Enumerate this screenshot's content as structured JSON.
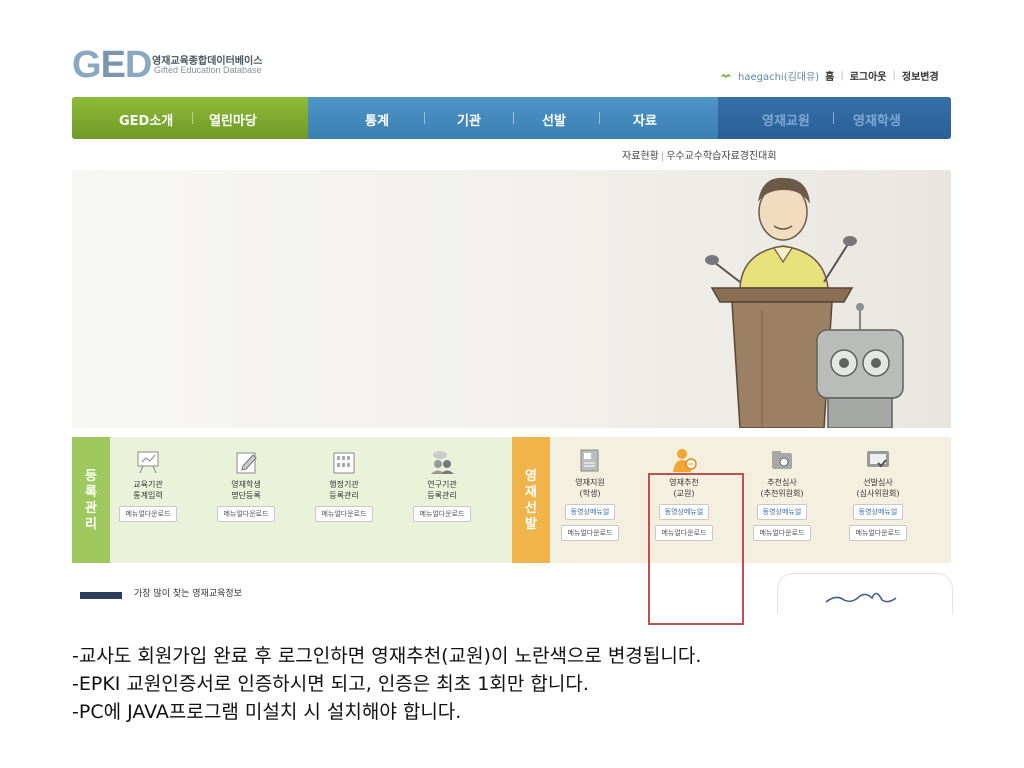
{
  "logo": {
    "letters": [
      "G",
      "E",
      "D"
    ],
    "kr": "영재교육종합데이터베이스",
    "en": "Gifted Education Database"
  },
  "toplinks": {
    "user": "haegachi(김대유)",
    "home": "홈",
    "logout": "로그아웃",
    "info": "정보변경"
  },
  "nav": {
    "items": [
      "GED소개",
      "열린마당",
      "통계",
      "기관",
      "선발",
      "자료",
      "영재교원",
      "영재학생"
    ]
  },
  "subnav": {
    "items": [
      "자료현황",
      "우수교수학습자료경진대회"
    ]
  },
  "panel": {
    "reg_title": [
      "등",
      "록",
      "관",
      "리"
    ],
    "sel_title": [
      "영",
      "재",
      "선",
      "발"
    ],
    "reg_items": [
      {
        "l1": "교육기관",
        "l2": "통계입력",
        "btn": "메뉴얼다운로드"
      },
      {
        "l1": "영재학생",
        "l2": "명단등록",
        "btn": "메뉴얼다운로드"
      },
      {
        "l1": "행정기관",
        "l2": "등록관리",
        "btn": "메뉴얼다운로드"
      },
      {
        "l1": "연구기관",
        "l2": "등록관리",
        "btn": "메뉴얼다운로드"
      }
    ],
    "sel_items": [
      {
        "l1": "영재지원",
        "l2": "(학생)",
        "video": "동영상메뉴얼",
        "btn": "메뉴얼다운로드"
      },
      {
        "l1": "영재추천",
        "l2": "(교원)",
        "video": "동영상메뉴얼",
        "btn": "메뉴얼다운로드"
      },
      {
        "l1": "추천심사",
        "l2": "(추천위원회)",
        "video": "동영상메뉴얼",
        "btn": "메뉴얼다운로드"
      },
      {
        "l1": "선발심사",
        "l2": "(심사위원회)",
        "video": "동영상메뉴얼",
        "btn": "메뉴얼다운로드"
      }
    ]
  },
  "bottom": {
    "popular": "가장 많이 찾는 영재교육정보"
  },
  "notes": [
    "-교사도 회원가입 완료 후 로그인하면 영재추천(교원)이 노란색으로 변경됩니다.",
    "-EPKI 교원인증서로 인증하시면 되고, 인증은 최초 1회만 합니다.",
    "-PC에 JAVA프로그램 미설치 시 설치해야 합니다."
  ]
}
